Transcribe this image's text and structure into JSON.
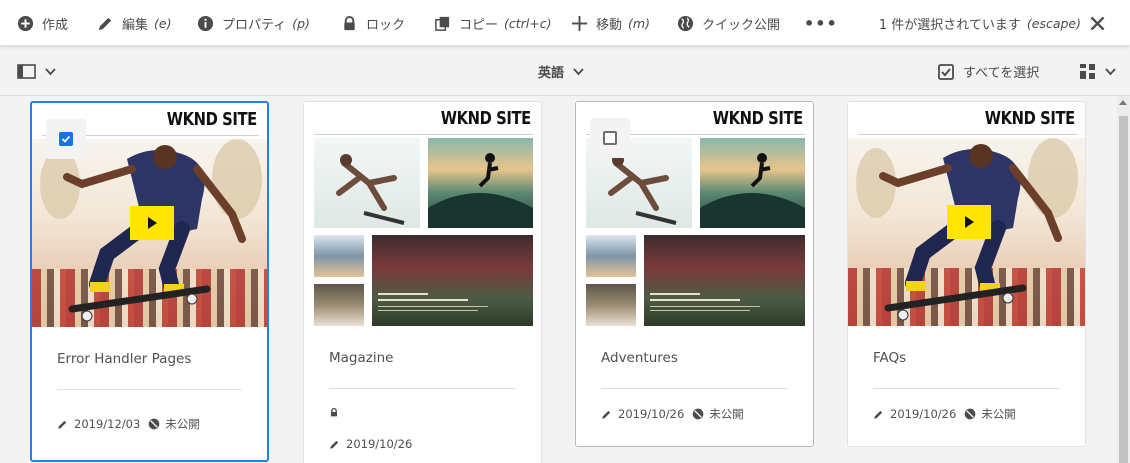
{
  "actionbar": {
    "create": "作成",
    "edit": "編集",
    "edit_key": "(e)",
    "properties": "プロパティ",
    "properties_key": "(p)",
    "lock": "ロック",
    "copy": "コピー",
    "copy_key": "(ctrl+c)",
    "move": "移動",
    "move_key": "(m)",
    "quick_publish": "クイック公開",
    "more": "•••",
    "selection_status": "1 件が選択されています",
    "escape_key": "(escape)"
  },
  "toolbar": {
    "language": "英語",
    "select_all": "すべてを選択"
  },
  "cards": [
    {
      "brand": "WKND SITE",
      "title": "Error Handler Pages",
      "thumbnail": "skater-video",
      "selected": true,
      "modified": "2019/12/03",
      "status": "未公開"
    },
    {
      "brand": "WKND SITE",
      "title": "Magazine",
      "thumbnail": "collage",
      "locked": true,
      "modified": "2019/10/26"
    },
    {
      "brand": "WKND SITE",
      "title": "Adventures",
      "thumbnail": "collage",
      "selected": false,
      "modified": "2019/10/26",
      "status": "未公開"
    },
    {
      "brand": "WKND SITE",
      "title": "FAQs",
      "thumbnail": "skater-video",
      "modified": "2019/10/26",
      "status": "未公開"
    }
  ],
  "colors": {
    "accent": "#2680eb",
    "checkbox": "#1473e6",
    "play_button": "#ffe500"
  }
}
